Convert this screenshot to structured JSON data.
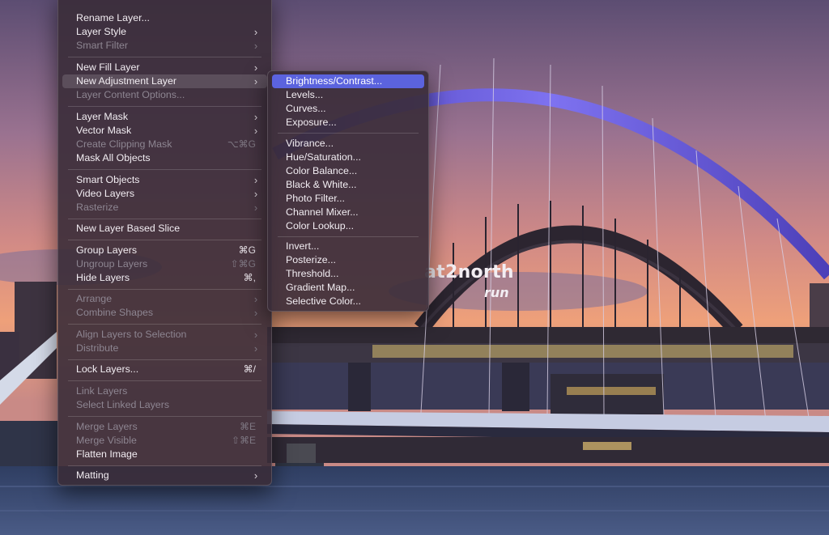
{
  "watermark": {
    "line1": "at2north",
    "line2": "run"
  },
  "main_menu": {
    "top_partial": "",
    "rename_layer": "Rename Layer...",
    "layer_style": "Layer Style",
    "smart_filter": "Smart Filter",
    "new_fill_layer": "New Fill Layer",
    "new_adjustment_layer": "New Adjustment Layer",
    "layer_content_options": "Layer Content Options...",
    "layer_mask": "Layer Mask",
    "vector_mask": "Vector Mask",
    "create_clipping_mask": "Create Clipping Mask",
    "create_clipping_mask_shortcut": "⌥⌘G",
    "mask_all_objects": "Mask All Objects",
    "smart_objects": "Smart Objects",
    "video_layers": "Video Layers",
    "rasterize": "Rasterize",
    "new_layer_based_slice": "New Layer Based Slice",
    "group_layers": "Group Layers",
    "group_layers_shortcut": "⌘G",
    "ungroup_layers": "Ungroup Layers",
    "ungroup_layers_shortcut": "⇧⌘G",
    "hide_layers": "Hide Layers",
    "hide_layers_shortcut": "⌘,",
    "arrange": "Arrange",
    "combine_shapes": "Combine Shapes",
    "align_layers": "Align Layers to Selection",
    "distribute": "Distribute",
    "lock_layers": "Lock Layers...",
    "lock_layers_shortcut": "⌘/",
    "link_layers": "Link Layers",
    "select_linked_layers": "Select Linked Layers",
    "merge_layers": "Merge Layers",
    "merge_layers_shortcut": "⌘E",
    "merge_visible": "Merge Visible",
    "merge_visible_shortcut": "⇧⌘E",
    "flatten_image": "Flatten Image",
    "matting": "Matting"
  },
  "submenu": {
    "brightness_contrast": "Brightness/Contrast...",
    "levels": "Levels...",
    "curves": "Curves...",
    "exposure": "Exposure...",
    "vibrance": "Vibrance...",
    "hue_saturation": "Hue/Saturation...",
    "color_balance": "Color Balance...",
    "black_white": "Black & White...",
    "photo_filter": "Photo Filter...",
    "channel_mixer": "Channel Mixer...",
    "color_lookup": "Color Lookup...",
    "invert": "Invert...",
    "posterize": "Posterize...",
    "threshold": "Threshold...",
    "gradient_map": "Gradient Map...",
    "selective_color": "Selective Color..."
  },
  "colors": {
    "highlight": "#5b63de",
    "menu_bg": "#3a2c38",
    "sky_top": "#5a4a6e",
    "sky_bottom": "#e89a78",
    "water": "#3a4c70",
    "bridge_arch": "#6a5ad8"
  }
}
